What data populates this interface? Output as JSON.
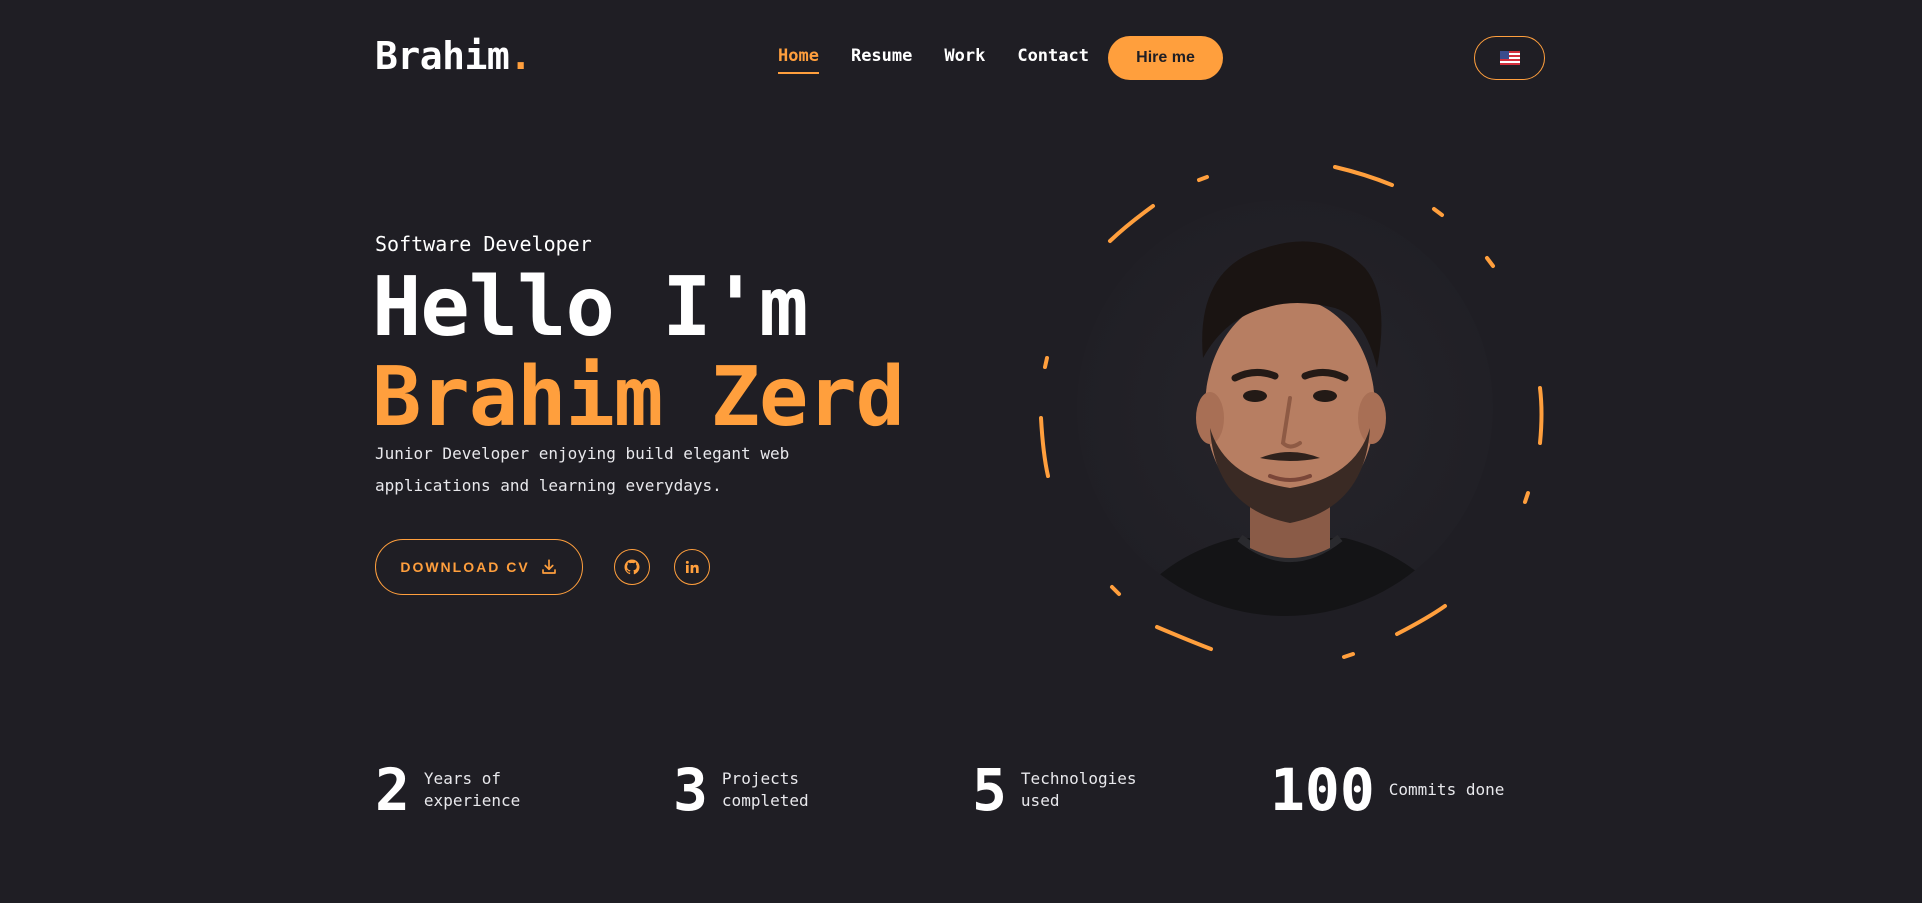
{
  "header": {
    "logo_text": "Brahim",
    "logo_dot": ".",
    "nav": [
      {
        "label": "Home"
      },
      {
        "label": "Resume"
      },
      {
        "label": "Work"
      },
      {
        "label": "Contact"
      }
    ],
    "hire_label": "Hire me",
    "language_flag": "us-flag-icon"
  },
  "hero": {
    "subtitle": "Software Developer",
    "greeting": "Hello I'm",
    "name": "Brahim Zerd",
    "description": "Junior Developer enjoying build elegant web applications and learning everydays.",
    "cv_label": "DOWNLOAD CV",
    "socials": [
      "github-icon",
      "linkedin-icon"
    ]
  },
  "stats": [
    {
      "number": "2",
      "label": "Years of experience"
    },
    {
      "number": "3",
      "label": "Projects completed"
    },
    {
      "number": "5",
      "label": "Technologies used"
    },
    {
      "number": "100",
      "label": "Commits done"
    }
  ],
  "colors": {
    "background": "#1f1e24",
    "accent": "#ff9f3d",
    "text": "#ffffff"
  }
}
